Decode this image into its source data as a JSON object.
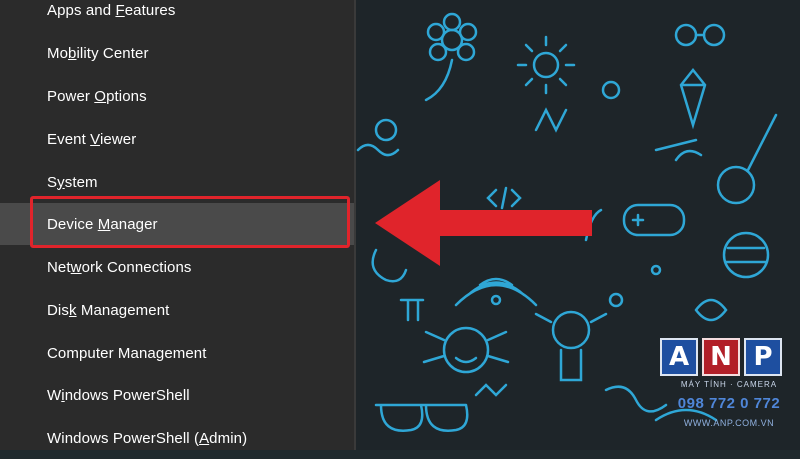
{
  "menu": {
    "items": [
      {
        "pre": "Apps and ",
        "key": "F",
        "post": "eatures"
      },
      {
        "pre": "Mo",
        "key": "b",
        "post": "ility Center"
      },
      {
        "pre": "Power ",
        "key": "O",
        "post": "ptions"
      },
      {
        "pre": "Event ",
        "key": "V",
        "post": "iewer"
      },
      {
        "pre": "S",
        "key": "y",
        "post": "stem"
      },
      {
        "pre": "Device ",
        "key": "M",
        "post": "anager"
      },
      {
        "pre": "Net",
        "key": "w",
        "post": "ork Connections"
      },
      {
        "pre": "Dis",
        "key": "k",
        "post": " Management"
      },
      {
        "pre": "Computer Mana",
        "key": "g",
        "post": "ement"
      },
      {
        "pre": "W",
        "key": "i",
        "post": "ndows PowerShell"
      },
      {
        "pre": "Windows PowerShell (",
        "key": "A",
        "post": "dmin)"
      }
    ],
    "highlighted_index": 5
  },
  "watermark": {
    "letters": [
      "A",
      "N",
      "P"
    ],
    "tagline": "MÁY TÍNH · CAMERA",
    "phone": "098 772 0 772",
    "url": "WWW.ANP.COM.VN"
  },
  "colors": {
    "menu_bg": "#2b2b2b",
    "menu_active": "#4a4a4a",
    "highlight_red": "#e0242b",
    "wallpaper_doodle": "#2fa7d6"
  }
}
